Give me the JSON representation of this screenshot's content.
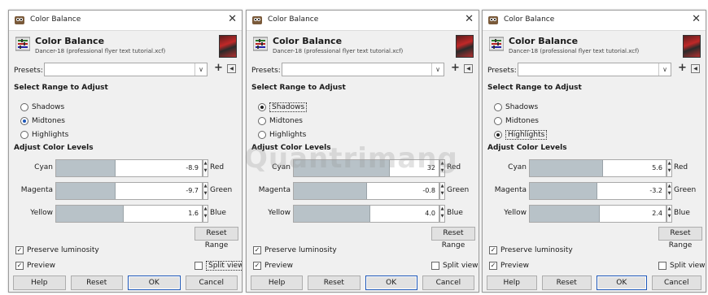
{
  "dialogs": [
    {
      "window_title": "Color Balance",
      "heading": "Color Balance",
      "subtitle": "Dancer-18 (professional flyer text tutorial.xcf)",
      "presets_label": "Presets:",
      "presets_value": "",
      "range_section": "Select Range to Adjust",
      "ranges": [
        "Shadows",
        "Midtones",
        "Highlights"
      ],
      "selected_range": "Midtones",
      "levels_section": "Adjust Color Levels",
      "sliders": [
        {
          "left": "Cyan",
          "value": "-8.9",
          "right": "Red",
          "fill": 0.4
        },
        {
          "left": "Magenta",
          "value": "-9.7",
          "right": "Green",
          "fill": 0.4
        },
        {
          "left": "Yellow",
          "value": "1.6",
          "right": "Blue",
          "fill": 0.46
        }
      ],
      "reset_range": "Reset Range",
      "preserve_luminosity": "Preserve luminosity",
      "preview": "Preview",
      "split_view": "Split view",
      "buttons": {
        "help": "Help",
        "reset": "Reset",
        "ok": "OK",
        "cancel": "Cancel"
      }
    },
    {
      "window_title": "Color Balance",
      "heading": "Color Balance",
      "subtitle": "Dancer-18 (professional flyer text tutorial.xcf)",
      "presets_label": "Presets:",
      "presets_value": "",
      "range_section": "Select Range to Adjust",
      "ranges": [
        "Shadows",
        "Midtones",
        "Highlights"
      ],
      "selected_range": "Shadows",
      "levels_section": "Adjust Color Levels",
      "sliders": [
        {
          "left": "Cyan",
          "value": "32",
          "right": "Red",
          "fill": 0.66
        },
        {
          "left": "Magenta",
          "value": "-0.8",
          "right": "Green",
          "fill": 0.5
        },
        {
          "left": "Yellow",
          "value": "4.0",
          "right": "Blue",
          "fill": 0.52
        }
      ],
      "reset_range": "Reset Range",
      "preserve_luminosity": "Preserve luminosity",
      "preview": "Preview",
      "split_view": "Split view",
      "buttons": {
        "help": "Help",
        "reset": "Reset",
        "ok": "OK",
        "cancel": "Cancel"
      }
    },
    {
      "window_title": "Color Balance",
      "heading": "Color Balance",
      "subtitle": "Dancer-18 (professional flyer text tutorial.xcf)",
      "presets_label": "Presets:",
      "presets_value": "",
      "range_section": "Select Range to Adjust",
      "ranges": [
        "Shadows",
        "Midtones",
        "Highlights"
      ],
      "selected_range": "Highlights",
      "levels_section": "Adjust Color Levels",
      "sliders": [
        {
          "left": "Cyan",
          "value": "5.6",
          "right": "Red",
          "fill": 0.53
        },
        {
          "left": "Magenta",
          "value": "-3.2",
          "right": "Green",
          "fill": 0.49
        },
        {
          "left": "Yellow",
          "value": "2.4",
          "right": "Blue",
          "fill": 0.51
        }
      ],
      "reset_range": "Reset Range",
      "preserve_luminosity": "Preserve luminosity",
      "preview": "Preview",
      "split_view": "Split view",
      "buttons": {
        "help": "Help",
        "reset": "Reset",
        "ok": "OK",
        "cancel": "Cancel"
      }
    }
  ],
  "watermark": "Quantrimang"
}
